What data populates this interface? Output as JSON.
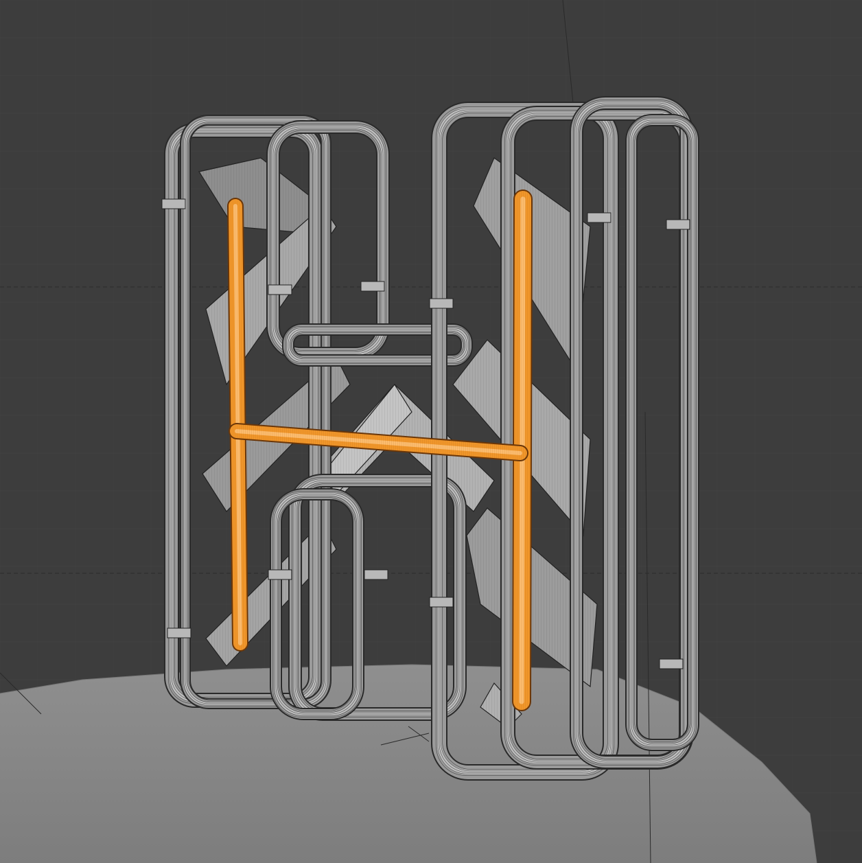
{
  "viewport": {
    "mode": "3d-viewport-wireframe-overlay",
    "background_color": "#3d3d3d",
    "grid_color": "#4a4a4a",
    "floor_color": "#8b8b8b",
    "mesh_color": "#9a9a9a",
    "mesh_edge_color": "#1e1e1e",
    "selection_color": "#f0962a"
  },
  "scene": {
    "objects": [
      {
        "name": "floor-disc",
        "selected": false
      },
      {
        "name": "h-shaped-frame-mesh",
        "selected": false
      },
      {
        "name": "letter-h-tube",
        "selected": true
      }
    ]
  }
}
